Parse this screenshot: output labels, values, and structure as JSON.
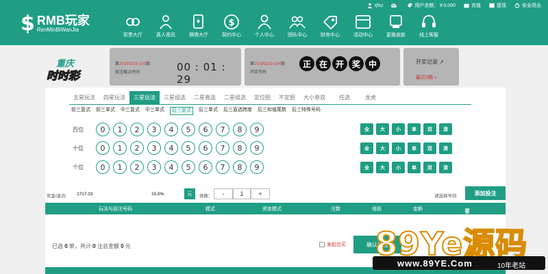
{
  "brand": {
    "logo_symbol": "$",
    "name": "RMB玩家",
    "sub": "RenMinBiWanJia"
  },
  "topbar": {
    "user": "rjfxz",
    "balance": "用户余额：￥0.000",
    "recharge": "充值",
    "withdraw": "提现",
    "logout": "安全退出"
  },
  "nav": [
    {
      "label": "彩票大厅",
      "icon": "lottery-hall-icon"
    },
    {
      "label": "真人视讯",
      "icon": "live-video-icon"
    },
    {
      "label": "棋牌大厅",
      "icon": "chess-cards-icon"
    },
    {
      "label": "契约中心",
      "icon": "contract-icon"
    },
    {
      "label": "个人中心",
      "icon": "person-icon"
    },
    {
      "label": "团队中心",
      "icon": "team-icon"
    },
    {
      "label": "财务中心",
      "icon": "finance-icon"
    },
    {
      "label": "活动中心",
      "icon": "activity-icon"
    },
    {
      "label": "更换皮肤",
      "icon": "skin-icon"
    },
    {
      "label": "线上客服",
      "icon": "headset-icon"
    }
  ],
  "draw": {
    "current_prefix": "第",
    "current_issue": "20190219-105",
    "current_suffix": "期",
    "current_sub": "投注截止时间",
    "countdown": "00 : 01 : 29",
    "prev_prefix": "第",
    "prev_issue": "20190219-104",
    "prev_suffix": "期",
    "prev_sub": "开奖号码",
    "balls": [
      "正",
      "在",
      "开",
      "奖",
      "中"
    ],
    "records": "开奖记录",
    "recent": "最近5期"
  },
  "tabs": [
    "五星玩法",
    "四星玩法",
    "三星玩法",
    "三星组选",
    "二星直选",
    "二星组选",
    "定位胆",
    "不定胆",
    "大小单双",
    "任选",
    "龙虎"
  ],
  "active_tab": 2,
  "subtabs": [
    "前三复式",
    "前三单式",
    "中三复式",
    "中三单式",
    "后三复式",
    "后三单式",
    "后三直选跨度",
    "后三和值尾数",
    "后三特殊号码"
  ],
  "active_subtab": 4,
  "rows": [
    {
      "label": "百位",
      "nums": [
        "0",
        "1",
        "2",
        "3",
        "4",
        "5",
        "6",
        "7",
        "8",
        "9"
      ]
    },
    {
      "label": "十位",
      "nums": [
        "0",
        "1",
        "2",
        "3",
        "4",
        "5",
        "6",
        "7",
        "8",
        "9"
      ]
    },
    {
      "label": "个位",
      "nums": [
        "0",
        "1",
        "2",
        "3",
        "4",
        "5",
        "6",
        "7",
        "8",
        "9"
      ]
    }
  ],
  "quick": [
    "全",
    "大",
    "小",
    "单",
    "双",
    "清"
  ],
  "controls": {
    "prize_label": "奖金/返点:",
    "prize": "1717.33",
    "rebate": "15.0%",
    "unit": "元",
    "multiple_label": "倍数：",
    "minus": "-",
    "multiple": "1",
    "plus": "+",
    "hint": "请选择号码",
    "add": "添加投注"
  },
  "table_head": [
    "玩法与投注号码",
    "模式",
    "资金模式",
    "注数",
    "倍投",
    "金额",
    "全删"
  ],
  "summary": {
    "p1": "已选",
    "notes": "0",
    "p2": "单，共计",
    "count": "0",
    "p3": "注总金额",
    "amount": "0",
    "p4": "元"
  },
  "follow": "发起合买",
  "bet_button": "确认投注",
  "watermark": {
    "big": "89Ye源码",
    "site": "www.89YE.Com",
    "tag": "10年老站"
  }
}
